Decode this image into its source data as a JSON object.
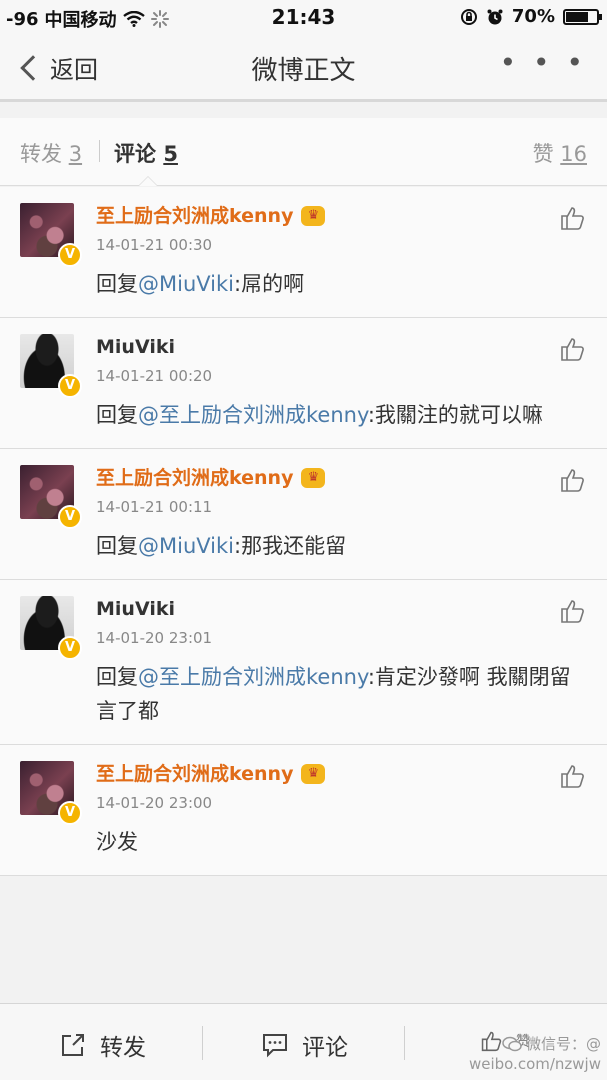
{
  "status_bar": {
    "signal": "-96",
    "carrier": "中国移动",
    "time": "21:43",
    "battery": "70%"
  },
  "nav": {
    "back_label": "返回",
    "title": "微博正文",
    "more_label": "• • •"
  },
  "tabs": {
    "forward_label": "转发",
    "forward_count": "3",
    "comment_label": "评论",
    "comment_count": "5",
    "like_label": "赞",
    "like_count": "16"
  },
  "comments": [
    {
      "avatar": "avatar-a",
      "name": "至上励合刘洲成kenny",
      "time": "14-01-21 00:30",
      "reply_prefix": "回复",
      "mention": "@MiuViki",
      "body": ":屌的啊"
    },
    {
      "avatar": "avatar-b",
      "name": "MiuViki",
      "time": "14-01-21 00:20",
      "reply_prefix": "回复",
      "mention": "@至上励合刘洲成kenny",
      "body": ":我關注的就可以嘛"
    },
    {
      "avatar": "avatar-a",
      "name": "至上励合刘洲成kenny",
      "time": "14-01-21 00:11",
      "reply_prefix": "回复",
      "mention": "@MiuViki",
      "body": ":那我还能留"
    },
    {
      "avatar": "avatar-b",
      "name": "MiuViki",
      "time": "14-01-20 23:01",
      "reply_prefix": "回复",
      "mention": "@至上励合刘洲成kenny",
      "body": ":肯定沙發啊 我關閉留言了都"
    },
    {
      "avatar": "avatar-a",
      "name": "至上励合刘洲成kenny",
      "time": "14-01-20 23:00",
      "reply_prefix": "",
      "mention": "",
      "body": "沙发"
    }
  ],
  "toolbar": {
    "forward_label": "转发",
    "comment_label": "评论",
    "like_label": "赞"
  },
  "watermark": {
    "line1": "微信号：@",
    "line2": "weibo.com/nzwjw"
  },
  "colors": {
    "name_orange": "#e06c18",
    "mention_blue": "#4a7aa8",
    "verified_gold": "#f5b400"
  }
}
